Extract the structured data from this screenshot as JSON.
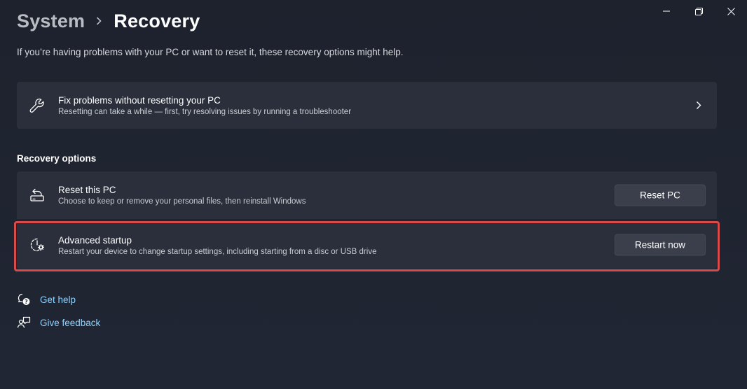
{
  "window_controls": {
    "minimize_icon": "minimize-icon",
    "restore_icon": "restore-icon",
    "close_icon": "close-icon"
  },
  "breadcrumb": {
    "parent": "System",
    "current": "Recovery"
  },
  "subtitle": "If you’re having problems with your PC or want to reset it, these recovery options might help.",
  "fix_card": {
    "icon": "wrench-icon",
    "title": "Fix problems without resetting your PC",
    "description": "Resetting can take a while — first, try resolving issues by running a troubleshooter"
  },
  "recovery_options": {
    "heading": "Recovery options",
    "items": [
      {
        "icon": "reset-pc-icon",
        "title": "Reset this PC",
        "description": "Choose to keep or remove your personal files, then reinstall Windows",
        "button_label": "Reset PC"
      },
      {
        "icon": "advanced-startup-icon",
        "title": "Advanced startup",
        "description": "Restart your device to change startup settings, including starting from a disc or USB drive",
        "button_label": "Restart now"
      }
    ]
  },
  "links": {
    "get_help": "Get help",
    "give_feedback": "Give feedback"
  },
  "colors": {
    "background": "#1f2430",
    "card": "#2a2f3b",
    "accent_link": "#8fd2ff",
    "highlight_border": "#d94b4b"
  }
}
